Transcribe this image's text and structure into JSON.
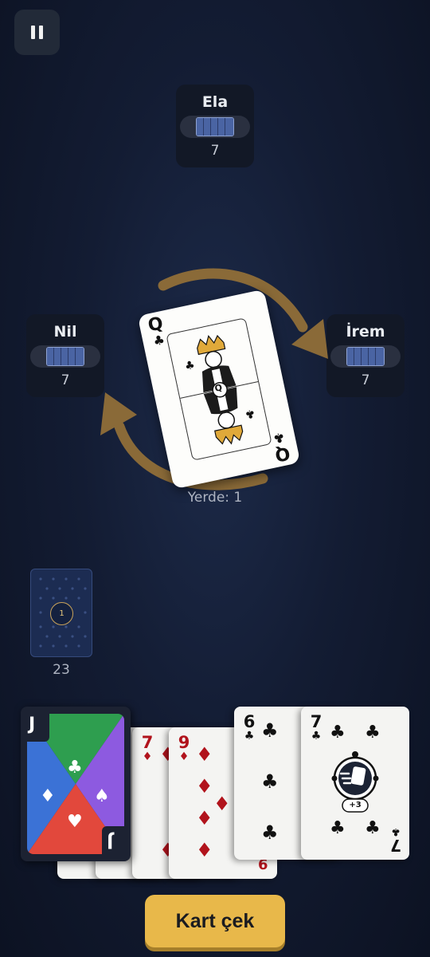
{
  "controls": {
    "pause_icon": "pause-icon"
  },
  "opponents": [
    {
      "name": "Ela",
      "card_count": "7"
    },
    {
      "name": "Nil",
      "card_count": "7"
    },
    {
      "name": "İrem",
      "card_count": "7"
    }
  ],
  "direction": {
    "arrows": "clockwise",
    "color": "#8a6a38"
  },
  "discard": {
    "top_card": {
      "rank": "Q",
      "suit": "♣",
      "center_label": "Q"
    },
    "label": "Yerde: 1"
  },
  "deck": {
    "badge": "1",
    "count": "23"
  },
  "hand": {
    "cards": [
      {
        "rank": "J",
        "type": "wild",
        "suits": [
          "♣",
          "♦",
          "♠",
          "♥"
        ],
        "colors": [
          "#2e9e4f",
          "#3b72d6",
          "#8d5ae0",
          "#e2483c"
        ]
      },
      {
        "rank": "",
        "suit": "♦"
      },
      {
        "rank": "7",
        "suit": "♦"
      },
      {
        "rank": "9",
        "suit": "♦",
        "bottom_rank": "6"
      },
      {
        "rank": "6",
        "suit": "♣"
      },
      {
        "rank": "7",
        "suit": "♣",
        "badge": "+3",
        "icon": "draw-three-icon"
      }
    ]
  },
  "actions": {
    "draw_label": "Kart çek"
  }
}
